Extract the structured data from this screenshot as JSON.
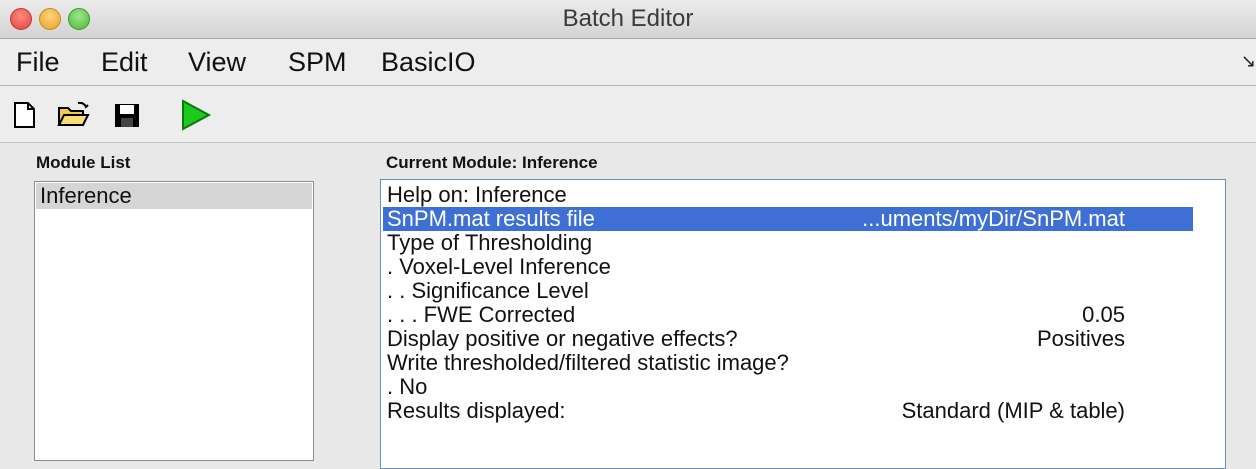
{
  "window": {
    "title": "Batch Editor"
  },
  "menu": {
    "items": [
      "File",
      "Edit",
      "View",
      "SPM",
      "BasicIO"
    ],
    "overflow_icon": "chevron-overflow-icon"
  },
  "toolbar": {
    "icons": [
      "new-file-icon",
      "open-folder-icon",
      "save-icon",
      "run-icon"
    ],
    "run_color": "#1ec81e"
  },
  "module_list": {
    "label": "Module List",
    "items": [
      "Inference"
    ]
  },
  "current_module": {
    "label": "Current Module: Inference",
    "rows": [
      {
        "label": "Help on: Inference",
        "value": ""
      },
      {
        "label": "SnPM.mat results file",
        "value": "...uments/myDir/SnPM.mat",
        "selected": true
      },
      {
        "label": "Type of Thresholding",
        "value": ""
      },
      {
        "label": " . Voxel-Level Inference",
        "value": ""
      },
      {
        "label": " . . Significance Level",
        "value": ""
      },
      {
        "label": " . . . FWE Corrected",
        "value": "0.05"
      },
      {
        "label": "Display positive or negative effects?",
        "value": "Positives"
      },
      {
        "label": "Write thresholded/filtered statistic image?",
        "value": ""
      },
      {
        "label": " . No",
        "value": ""
      },
      {
        "label": "Results displayed:",
        "value": "Standard (MIP & table)"
      }
    ]
  },
  "colors": {
    "selection": "#3d6fd4"
  }
}
